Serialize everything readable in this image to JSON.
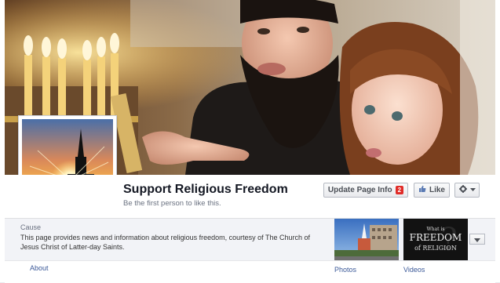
{
  "page": {
    "name": "Support Religious Freedom",
    "likes_text": "Be the first person to like this."
  },
  "actions": {
    "update_label": "Update Page Info",
    "update_badge": "2",
    "like_label": "Like"
  },
  "about": {
    "label": "Cause",
    "description": "This page provides news and information about religious freedom, courtesy of The Church of Jesus Christ of Latter-day Saints.",
    "tab_label": "About"
  },
  "apps": {
    "photos_label": "Photos",
    "videos_label": "Videos",
    "videos_thumb_line1": "What is",
    "videos_thumb_line2": "FREEDOM",
    "videos_thumb_line3": "of RELIGION"
  },
  "icons": {
    "like": "thumbs-up-icon",
    "settings": "gear-icon",
    "more": "chevron-down-icon"
  },
  "colors": {
    "link": "#3b5998",
    "badge": "#e02b27",
    "title": "#141823"
  }
}
